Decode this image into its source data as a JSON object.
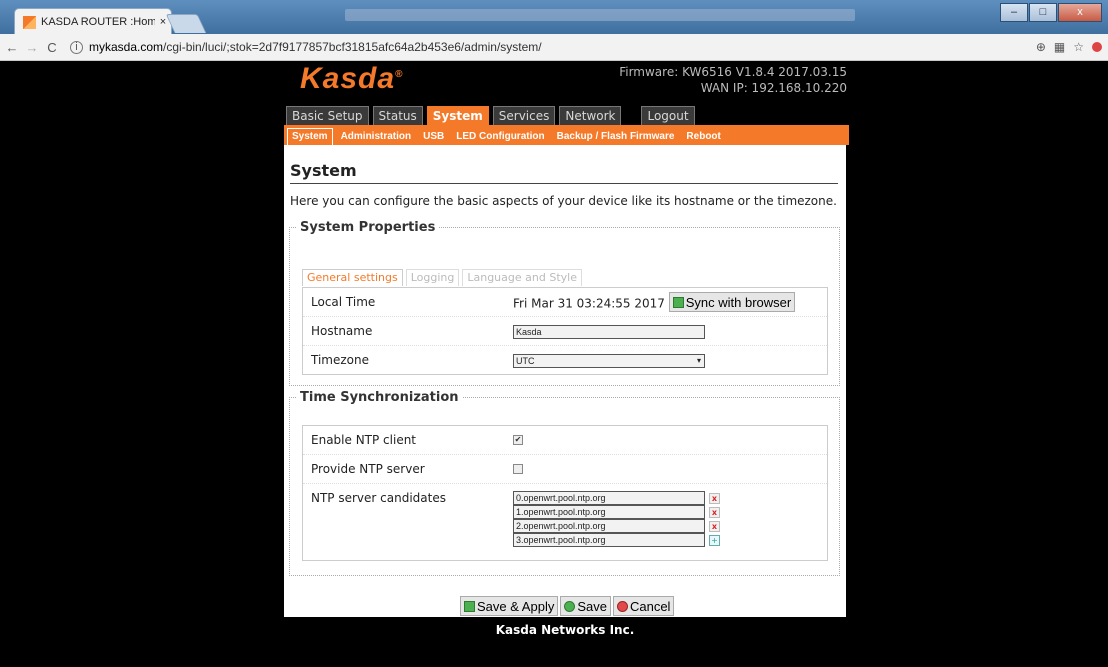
{
  "browser": {
    "tab_title": "KASDA ROUTER :Home",
    "tab_close": "×",
    "url_host": "mykasda.com",
    "url_path": "/cgi-bin/luci/;stok=2d7f9177857bcf31815afc64a2b453e6/admin/system/",
    "back": "←",
    "forward": "→",
    "reload": "C",
    "info": "i",
    "zoom_icon": "⊕",
    "translate_icon": "▦",
    "star_icon": "☆",
    "window_min": "–",
    "window_max": "□",
    "window_close": "x"
  },
  "header": {
    "logo": "Kasda",
    "logo_reg": "®",
    "firmware": "Firmware: KW6516 V1.8.4 2017.03.15",
    "wan_ip": "WAN IP: 192.168.10.220"
  },
  "main_nav": [
    "Basic Setup",
    "Status",
    "System",
    "Services",
    "Network",
    "Logout"
  ],
  "sub_nav": [
    "System",
    "Administration",
    "USB",
    "LED Configuration",
    "Backup / Flash Firmware",
    "Reboot"
  ],
  "page": {
    "title": "System",
    "description": "Here you can configure the basic aspects of your device like its hostname or the timezone."
  },
  "system_properties": {
    "legend": "System Properties",
    "tabs": [
      "General settings",
      "Logging",
      "Language and Style"
    ],
    "local_time_label": "Local Time",
    "local_time_value": "Fri Mar 31 03:24:55 2017",
    "sync_button": "Sync with browser",
    "hostname_label": "Hostname",
    "hostname_value": "Kasda",
    "timezone_label": "Timezone",
    "timezone_value": "UTC",
    "timezone_arrow": "▾"
  },
  "time_sync": {
    "legend": "Time Synchronization",
    "enable_ntp_label": "Enable NTP client",
    "enable_ntp_checked": "✔",
    "provide_ntp_label": "Provide NTP server",
    "ntp_candidates_label": "NTP server candidates",
    "candidates": [
      "0.openwrt.pool.ntp.org",
      "1.openwrt.pool.ntp.org",
      "2.openwrt.pool.ntp.org",
      "3.openwrt.pool.ntp.org"
    ],
    "remove_icon": "x",
    "add_icon": "+"
  },
  "actions": {
    "save_apply": "Save & Apply",
    "save": "Save",
    "cancel": "Cancel"
  },
  "footer": "Kasda Networks Inc."
}
